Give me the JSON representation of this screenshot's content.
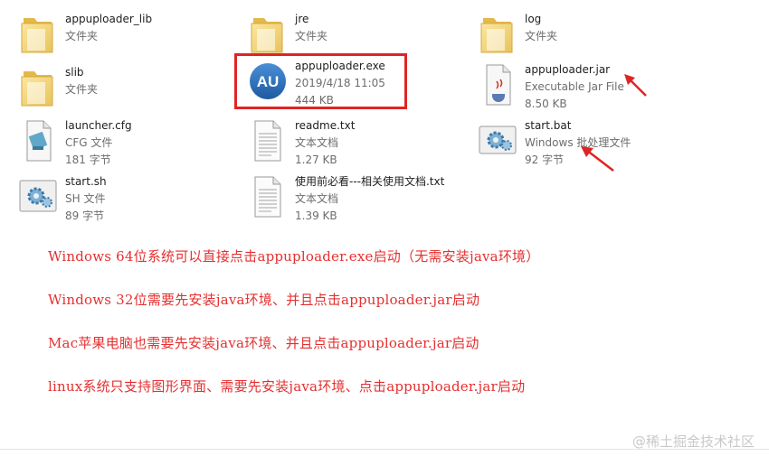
{
  "files": [
    {
      "name": "appuploader_lib",
      "type": "文件夹",
      "size": ""
    },
    {
      "name": "jre",
      "type": "文件夹",
      "size": ""
    },
    {
      "name": "log",
      "type": "文件夹",
      "size": ""
    },
    {
      "name": "slib",
      "type": "文件夹",
      "size": ""
    },
    {
      "name": "appuploader.exe",
      "type": "2019/4/18 11:05",
      "size": "444 KB",
      "icon_text": "AU"
    },
    {
      "name": "appuploader.jar",
      "type": "Executable Jar File",
      "size": "8.50 KB"
    },
    {
      "name": "launcher.cfg",
      "type": "CFG 文件",
      "size": "181 字节"
    },
    {
      "name": "readme.txt",
      "type": "文本文档",
      "size": "1.27 KB"
    },
    {
      "name": "start.bat",
      "type": "Windows 批处理文件",
      "size": "92 字节"
    },
    {
      "name": "start.sh",
      "type": "SH 文件",
      "size": "89 字节"
    },
    {
      "name": "使用前必看---相关使用文档.txt",
      "type": "文本文档",
      "size": "1.39 KB"
    }
  ],
  "notes": [
    "Windows 64位系统可以直接点击appuploader.exe启动（无需安装java环境）",
    "Windows 32位需要先安装java环境、并且点击appuploader.jar启动",
    "Mac苹果电脑也需要先安装java环境、并且点击appuploader.jar启动",
    "linux系统只支持图形界面、需要先安装java环境、点击appuploader.jar启动"
  ],
  "watermark": "@稀土掘金技术社区",
  "colors": {
    "note_red": "#e53030",
    "highlight_red": "#e02424",
    "au_blue": "#2f6fb5"
  }
}
